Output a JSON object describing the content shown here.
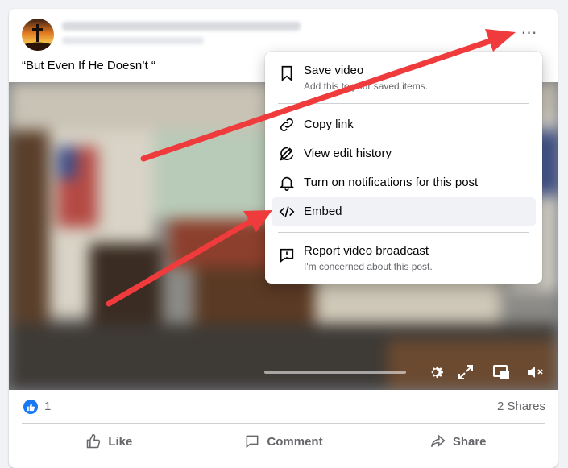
{
  "post": {
    "text": "“But Even If He Doesn’t “",
    "more_icon": "⋯"
  },
  "menu": {
    "items": [
      {
        "label": "Save video",
        "sub": "Add this to your saved items."
      },
      {
        "label": "Copy link"
      },
      {
        "label": "View edit history"
      },
      {
        "label": "Turn on notifications for this post"
      },
      {
        "label": "Embed"
      },
      {
        "label": "Report video broadcast",
        "sub": "I'm concerned about this post."
      }
    ]
  },
  "stats": {
    "likes": "1",
    "shares": "2 Shares"
  },
  "actions": {
    "like": "Like",
    "comment": "Comment",
    "share": "Share"
  },
  "colors": {
    "annotation_arrow": "#ef3b3b",
    "like_blue": "#1877f2"
  }
}
